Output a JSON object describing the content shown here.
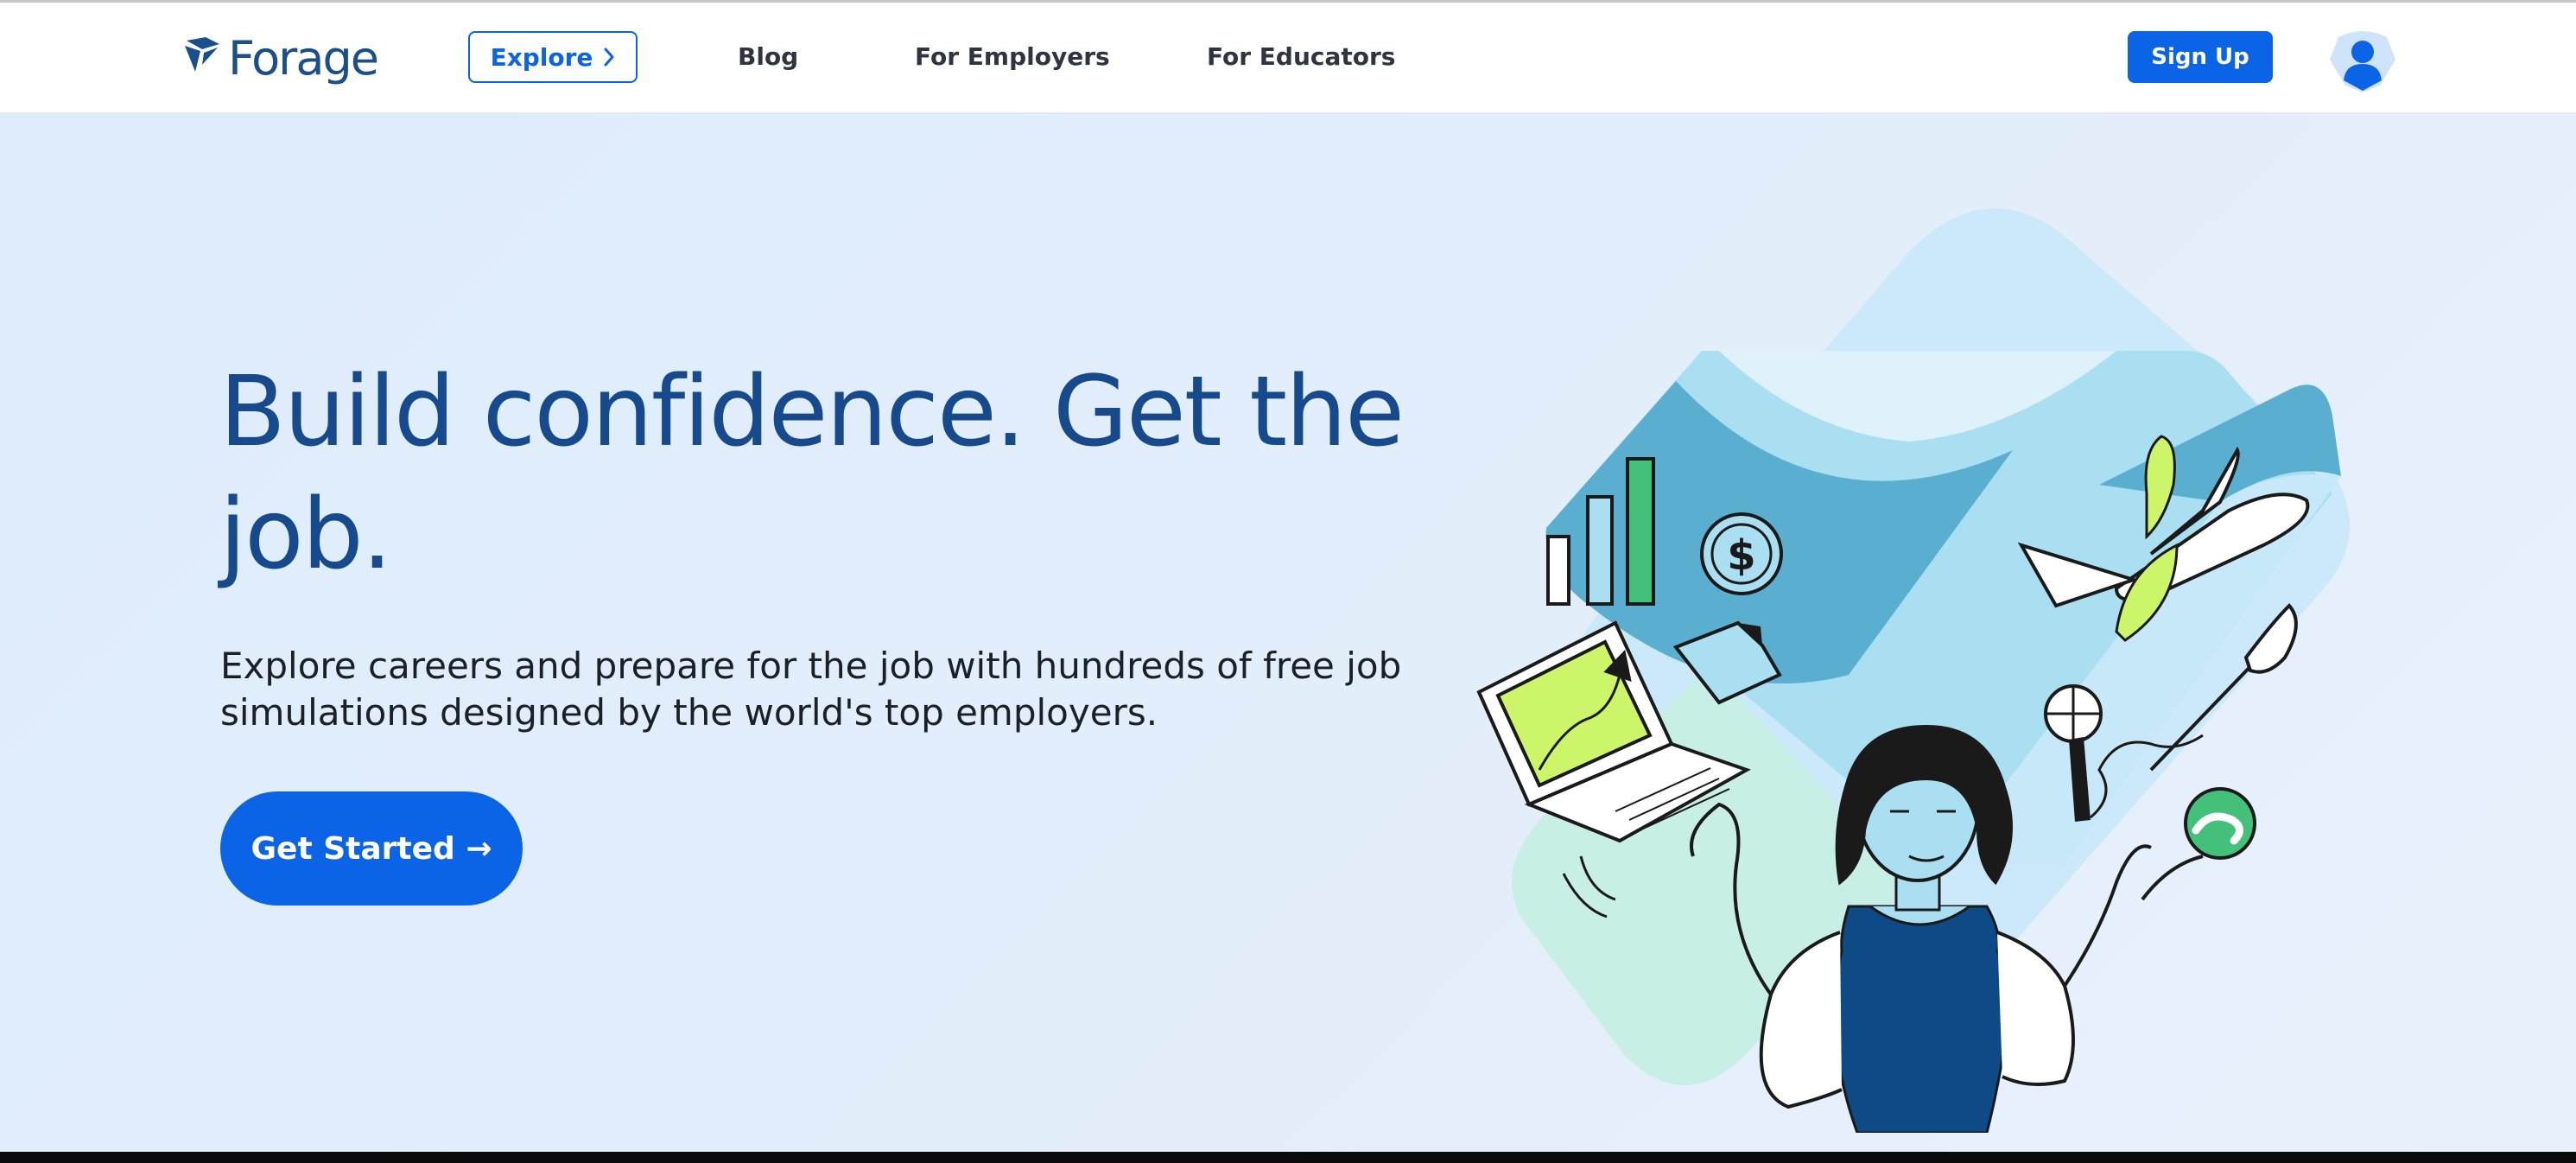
{
  "navbar": {
    "logo_text": "Forage",
    "explore_label": "Explore",
    "links": [
      {
        "label": "Blog"
      },
      {
        "label": "For Employers"
      },
      {
        "label": "For Educators"
      }
    ],
    "signup_label": "Sign Up",
    "icons": {
      "logo": "forage-logo-icon",
      "explore_chevron": "chevron-right-icon",
      "avatar": "user-avatar-icon"
    }
  },
  "hero": {
    "headline": "Build confidence. Get the job.",
    "subtext": "Explore careers and prepare for the job with hundreds of free job simulations designed by the world's top employers.",
    "cta_label": "Get Started →",
    "illustration": {
      "icons": [
        "bar-chart-icon",
        "dollar-coin-icon",
        "laptop-icon",
        "document-icon",
        "airplane-icon",
        "leaf-icon",
        "paintbrush-icon",
        "microphone-icon",
        "ball-icon",
        "person-illustration"
      ]
    }
  },
  "colors": {
    "brand_blue": "#0b63e5",
    "headline_blue": "#174a8c",
    "hero_bg": "#e0edfb",
    "nav_text": "#2e3440"
  }
}
